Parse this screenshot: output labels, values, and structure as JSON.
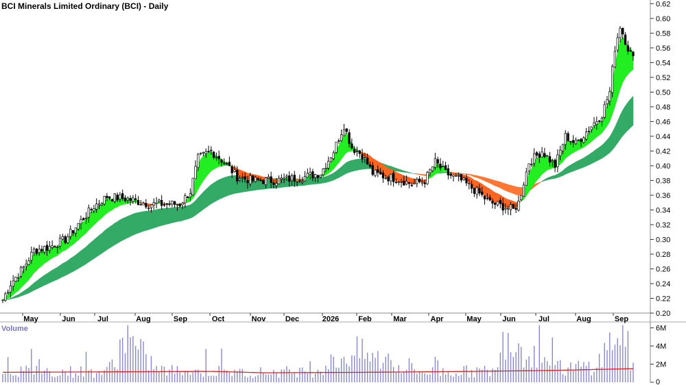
{
  "chart_data": {
    "type": "candlestick",
    "title": "BCI Minerals Limited Ordinary (BCI) - Daily",
    "volume_label": "Volume",
    "x_tick_labels": [
      "May",
      "Jun",
      "Jul",
      "Aug",
      "Sep",
      "Oct",
      "Nov",
      "Dec",
      "2026",
      "Feb",
      "Mar",
      "Apr",
      "May",
      "Jun",
      "Jul",
      "Aug",
      "Sep"
    ],
    "y_ticks": [
      0.2,
      0.22,
      0.24,
      0.26,
      0.28,
      0.3,
      0.32,
      0.34,
      0.36,
      0.38,
      0.4,
      0.42,
      0.44,
      0.46,
      0.48,
      0.5,
      0.52,
      0.54,
      0.56,
      0.58,
      0.6,
      0.62
    ],
    "y_tick_labels": [
      "0.20",
      "0.22",
      "0.24",
      "0.26",
      "0.28",
      "0.30",
      "0.32",
      "0.34",
      "0.36",
      "0.38",
      "0.40",
      "0.42",
      "0.44",
      "0.46",
      "0.48",
      "0.50",
      "0.52",
      "0.54",
      "0.56",
      "0.58",
      "0.60",
      "0.62"
    ],
    "ylim": [
      0.2,
      0.625
    ],
    "volume_ticks": [
      0,
      2000000,
      4000000,
      6000000
    ],
    "volume_tick_labels": [
      "0",
      "2M",
      "4M",
      "6M"
    ],
    "volume_ylim": [
      0,
      6500000
    ],
    "price_key_points": [
      [
        0,
        0.218
      ],
      [
        3,
        0.24
      ],
      [
        8,
        0.262
      ],
      [
        12,
        0.285
      ],
      [
        18,
        0.29
      ],
      [
        24,
        0.3
      ],
      [
        30,
        0.325
      ],
      [
        35,
        0.345
      ],
      [
        40,
        0.358
      ],
      [
        48,
        0.355
      ],
      [
        56,
        0.348
      ],
      [
        62,
        0.348
      ],
      [
        68,
        0.348
      ],
      [
        72,
        0.365
      ],
      [
        75,
        0.41
      ],
      [
        80,
        0.42
      ],
      [
        85,
        0.405
      ],
      [
        90,
        0.385
      ],
      [
        96,
        0.38
      ],
      [
        104,
        0.38
      ],
      [
        110,
        0.382
      ],
      [
        116,
        0.385
      ],
      [
        122,
        0.39
      ],
      [
        127,
        0.42
      ],
      [
        131,
        0.455
      ],
      [
        134,
        0.425
      ],
      [
        138,
        0.415
      ],
      [
        142,
        0.39
      ],
      [
        147,
        0.385
      ],
      [
        152,
        0.382
      ],
      [
        157,
        0.375
      ],
      [
        162,
        0.38
      ],
      [
        166,
        0.405
      ],
      [
        170,
        0.39
      ],
      [
        176,
        0.38
      ],
      [
        182,
        0.365
      ],
      [
        187,
        0.35
      ],
      [
        192,
        0.345
      ],
      [
        196,
        0.34
      ],
      [
        198,
        0.35
      ],
      [
        202,
        0.405
      ],
      [
        207,
        0.42
      ],
      [
        212,
        0.4
      ],
      [
        216,
        0.44
      ],
      [
        220,
        0.43
      ],
      [
        225,
        0.45
      ],
      [
        230,
        0.47
      ],
      [
        233,
        0.5
      ],
      [
        235,
        0.56
      ],
      [
        237,
        0.59
      ],
      [
        238,
        0.58
      ],
      [
        240,
        0.56
      ],
      [
        242,
        0.545
      ]
    ],
    "volume_key_points": [
      [
        0,
        1300000
      ],
      [
        40,
        1200000
      ],
      [
        47,
        5000000
      ],
      [
        60,
        1400000
      ],
      [
        90,
        1100000
      ],
      [
        120,
        1300000
      ],
      [
        130,
        2800000
      ],
      [
        135,
        3500000
      ],
      [
        160,
        1200000
      ],
      [
        190,
        1300000
      ],
      [
        192,
        6000000
      ],
      [
        200,
        4000000
      ],
      [
        215,
        1500000
      ],
      [
        228,
        2000000
      ],
      [
        236,
        5800000
      ],
      [
        238,
        6200000
      ],
      [
        242,
        1500000
      ]
    ],
    "volume_ma": [
      [
        0,
        1100000
      ],
      [
        40,
        1150000
      ],
      [
        80,
        1200000
      ],
      [
        100,
        1050000
      ],
      [
        140,
        1100000
      ],
      [
        180,
        1200000
      ],
      [
        210,
        1300000
      ],
      [
        242,
        1500000
      ]
    ],
    "colors": {
      "short_ma_up": "#22ee22",
      "short_ma_down": "#ff6622",
      "long_ma_band": "#33aa66",
      "long_ma_band_down": "#ff7733",
      "transition": "#ffb3b3",
      "candle": "#000000",
      "volume_bar": "#8888cc",
      "volume_ma": "#dd2222",
      "grid": "#cccccc"
    }
  }
}
